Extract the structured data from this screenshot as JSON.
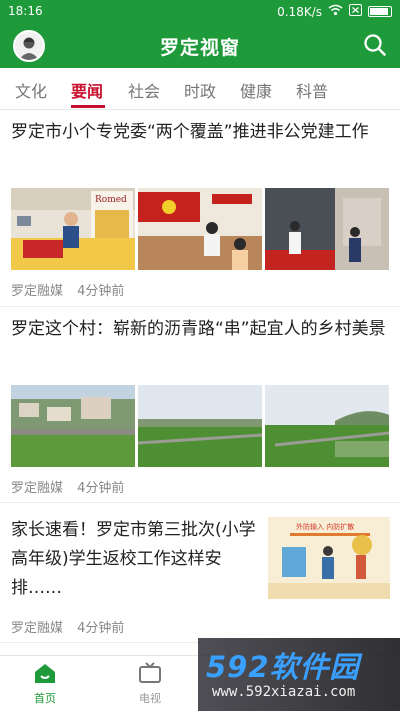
{
  "status_bar": {
    "time": "18:16",
    "speed": "0.18K/s",
    "wifi_icon": "wifi-icon",
    "sim_icon": "sim-icon",
    "battery_level": 0.9
  },
  "header": {
    "title": "罗定视窗",
    "avatar_icon": "avatar-icon",
    "search_icon": "search-icon"
  },
  "tabs": [
    {
      "label": "文化",
      "active": false
    },
    {
      "label": "要闻",
      "active": true
    },
    {
      "label": "社会",
      "active": false
    },
    {
      "label": "时政",
      "active": false
    },
    {
      "label": "健康",
      "active": false
    },
    {
      "label": "科普",
      "active": false
    }
  ],
  "articles": [
    {
      "title": "罗定市小个专党委“两个覆盖”推进非公党建工作",
      "source": "罗定融媒",
      "time": "4分钟前",
      "signboard": "Romed"
    },
    {
      "title": "罗定这个村：崭新的沥青路“串”起宜人的乡村美景",
      "source": "罗定融媒",
      "time": "4分钟前"
    },
    {
      "title": "家长速看！罗定市第三批次(小学高年级)学生返校工作这样安排……",
      "source": "罗定融媒",
      "time": "4分钟前",
      "poster_text": "外防输入  内防扩散"
    }
  ],
  "bottom_nav": [
    {
      "label": "首页",
      "icon": "home-icon",
      "active": true
    },
    {
      "label": "电视",
      "icon": "tv-icon",
      "active": false
    }
  ],
  "watermark": {
    "brand": "592软件园",
    "url": "www.592xiazai.com"
  },
  "colors": {
    "brand_green": "#1f9a3a",
    "tab_active": "#c8102e",
    "meta_gray": "#888888"
  }
}
